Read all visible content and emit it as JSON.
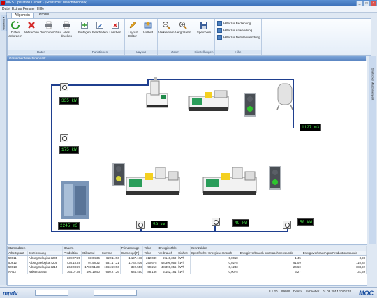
{
  "window": {
    "title": "MES Operation Center - [Grafischer Maschinenpark]",
    "min": "_",
    "max": "□",
    "close": "×"
  },
  "menu": [
    "Datei",
    "Extras",
    "Fenster",
    "Hilfe"
  ],
  "left_strip": {
    "tab": "Grafikpark"
  },
  "ribbon": {
    "tabs": [
      "Allgemein",
      "Profile"
    ],
    "groups": {
      "daten": {
        "label": "Daten",
        "buttons": [
          "Daten anfordern",
          "Abbrechen",
          "Druckvorschau",
          "Alles drucken"
        ]
      },
      "funktionen": {
        "label": "Funktionen",
        "buttons": [
          "Einfügen",
          "Bearbeiten",
          "Löschen"
        ]
      },
      "layout": {
        "label": "Layout",
        "buttons": [
          "Layout Editor",
          "Vollbild"
        ]
      },
      "zoom": {
        "label": "Zoom",
        "buttons": [
          "Verkleinern",
          "Vergrößern"
        ]
      },
      "einstellungen": {
        "label": "Einstellungen",
        "buttons": [
          "Speichern"
        ]
      },
      "hilfe": {
        "label": "Hilfe",
        "buttons": [
          "Hilfe zur Bedienung",
          "Hilfe zur Anwendung",
          "Hilfe zur Detailanwendung"
        ]
      }
    }
  },
  "workspace": {
    "header": "Grafischer Maschinenpark",
    "right_tab": "Grafischer Maschinenpark"
  },
  "readouts": {
    "r1": "335 kW",
    "r2": "175 kW",
    "r3": "2245 m3",
    "r4": "1127 m3",
    "r5": "59 kW",
    "r6": "49 kW",
    "r7": "50 kW"
  },
  "lamps": {
    "top": {
      "color": "#2ec42e"
    },
    "mid_left": {
      "color": "#d9d63a"
    },
    "mid_right": {
      "color": "#2ec42e"
    }
  },
  "table": {
    "group_headers": [
      "Stammdaten",
      "Dauern",
      "Primärmenge",
      "Takte",
      "Energiezähler",
      "Kennzahlen"
    ],
    "columns": [
      "Arbeitsplatz",
      "Bezeichnung",
      "Produktion",
      "Stillstand",
      "Summe",
      "Gutmenge[P]",
      "Takte",
      "Verbrauch",
      "Einheit",
      "Spezifischer Energieverbrauch",
      "Energieverbrauch pro Maschinenstunde",
      "Energieverbrauch pro Produktionsstunde"
    ],
    "rows": [
      [
        "50611",
        "Arburg Selogica 3205",
        "339:07:20",
        "83:04:36",
        "622:11:56",
        "1.197.178",
        "312.049",
        "2.146,369",
        "kWh",
        "0,0018",
        "1,45",
        "3,98"
      ],
      [
        "50612",
        "Arburg Selogica 4205",
        "436:18:49",
        "94:58:32",
        "531:17:21",
        "1.742.406",
        "290.675",
        "48.396,056",
        "kWh",
        "0,0278",
        "91,09",
        "110,82"
      ],
      [
        "50613",
        "Arburg Selogica 3215",
        "263:08:27",
        "1703:51:29",
        "1966:59:56",
        "392.556",
        "99.210",
        "48.396,056",
        "kWh",
        "0,1233",
        "24,60",
        "183,92"
      ],
      [
        "NA43",
        "Nakamura 43",
        "164:07:36",
        "496:19:50",
        "660:27:26",
        "684.450",
        "88.156",
        "5.152,181",
        "kWh",
        "0,0075",
        "6,27",
        "31,39"
      ]
    ]
  },
  "status": {
    "version": "8.1.20",
    "code": "99999",
    "user": "Demo",
    "mode": "Schreiber",
    "datetime": "01.08.2014 10:02:42",
    "logo_left": "mpdv",
    "logo_right": "MOC"
  }
}
